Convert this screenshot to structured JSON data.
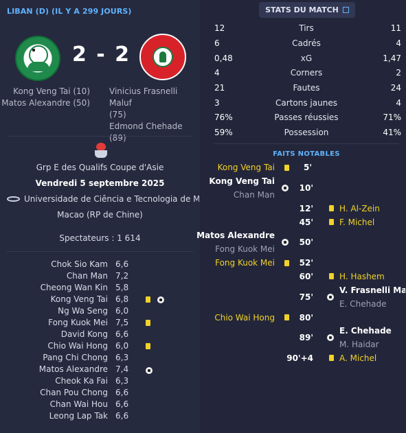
{
  "header": {
    "title": "LIBAN (D) (IL Y A 299 JOURS)"
  },
  "score": "2 - 2",
  "scorers": {
    "home": [
      "Kong Veng Tai (10)",
      "Matos Alexandre (50)"
    ],
    "away": [
      "Vinicius Frasnelli Maluf",
      "(75)",
      "Edmond Chehade (89)"
    ]
  },
  "match_info": {
    "competition": "Grp E des Qualifs Coupe d'Asie",
    "date": "Vendredi 5 septembre 2025",
    "stadium": "Universidade de Ciência e Tecnologia de Mac…",
    "city": "Macao (RP de Chine)",
    "spectators": "Spectateurs : 1 614"
  },
  "lineup": [
    {
      "name": "Chok Sio Kam",
      "rating": "6,6"
    },
    {
      "name": "Chan Man",
      "rating": "7,2"
    },
    {
      "name": "Cheong Wan Kin",
      "rating": "5,8"
    },
    {
      "name": "Kong Veng Tai",
      "rating": "6,8"
    },
    {
      "name": "Ng Wa Seng",
      "rating": "6,0"
    },
    {
      "name": "Fong Kuok Mei",
      "rating": "7,5"
    },
    {
      "name": "David Kong",
      "rating": "6,6"
    },
    {
      "name": "Chio Wai Hong",
      "rating": "6,0"
    },
    {
      "name": "Pang Chi Chong",
      "rating": "6,3"
    },
    {
      "name": "Matos Alexandre",
      "rating": "7,4"
    },
    {
      "name": "Cheok Ka Fai",
      "rating": "6,3"
    },
    {
      "name": "Chan Pou Chong",
      "rating": "6,6"
    },
    {
      "name": "Chan Wai Hou",
      "rating": "6,6"
    },
    {
      "name": "Leong Lap Tak",
      "rating": "6,6"
    }
  ],
  "stats_button": {
    "label": "STATS DU MATCH"
  },
  "stats": [
    {
      "home": "12",
      "label": "Tirs",
      "away": "11"
    },
    {
      "home": "6",
      "label": "Cadrés",
      "away": "4"
    },
    {
      "home": "0,48",
      "label": "xG",
      "away": "1,47"
    },
    {
      "home": "4",
      "label": "Corners",
      "away": "2"
    },
    {
      "home": "21",
      "label": "Fautes",
      "away": "24"
    },
    {
      "home": "3",
      "label": "Cartons jaunes",
      "away": "4"
    },
    {
      "home": "76%",
      "label": "Passes réussies",
      "away": "71%"
    },
    {
      "home": "59%",
      "label": "Possession",
      "away": "41%"
    }
  ],
  "events_title": "FAITS NOTABLES",
  "events": [
    {
      "side": "home",
      "type": "yellow",
      "minute": "5'",
      "player": "Kong Veng Tai",
      "assist": ""
    },
    {
      "side": "home",
      "type": "goal",
      "minute": "10'",
      "player": "Kong Veng Tai",
      "assist": "Chan Man"
    },
    {
      "side": "away",
      "type": "yellow",
      "minute": "12'",
      "player": "H. Al-Zein",
      "assist": ""
    },
    {
      "side": "away",
      "type": "yellow",
      "minute": "45'",
      "player": "F. Michel",
      "assist": ""
    },
    {
      "side": "home",
      "type": "goal",
      "minute": "50'",
      "player": "Matos Alexandre",
      "assist": "Fong Kuok Mei"
    },
    {
      "side": "home",
      "type": "yellow",
      "minute": "52'",
      "player": "Fong Kuok Mei",
      "assist": ""
    },
    {
      "side": "away",
      "type": "yellow",
      "minute": "60'",
      "player": "H. Hashem",
      "assist": ""
    },
    {
      "side": "away",
      "type": "goal",
      "minute": "75'",
      "player": "V. Frasnelli Mal…",
      "assist": "E. Chehade"
    },
    {
      "side": "home",
      "type": "yellow",
      "minute": "80'",
      "player": "Chio Wai Hong",
      "assist": ""
    },
    {
      "side": "away",
      "type": "goal",
      "minute": "89'",
      "player": "E. Chehade",
      "assist": "M. Haidar"
    },
    {
      "side": "away",
      "type": "yellow",
      "minute": "90'+4",
      "player": "A. Michel",
      "assist": ""
    }
  ],
  "colors": {
    "accent": "#5fb3ff",
    "yellow_card": "#f1d22a",
    "background": "#23263a"
  },
  "icons": {
    "goal": "football-icon",
    "card": "yellow-card-icon",
    "stadium": "stadium-icon",
    "link": "external-link-icon"
  }
}
